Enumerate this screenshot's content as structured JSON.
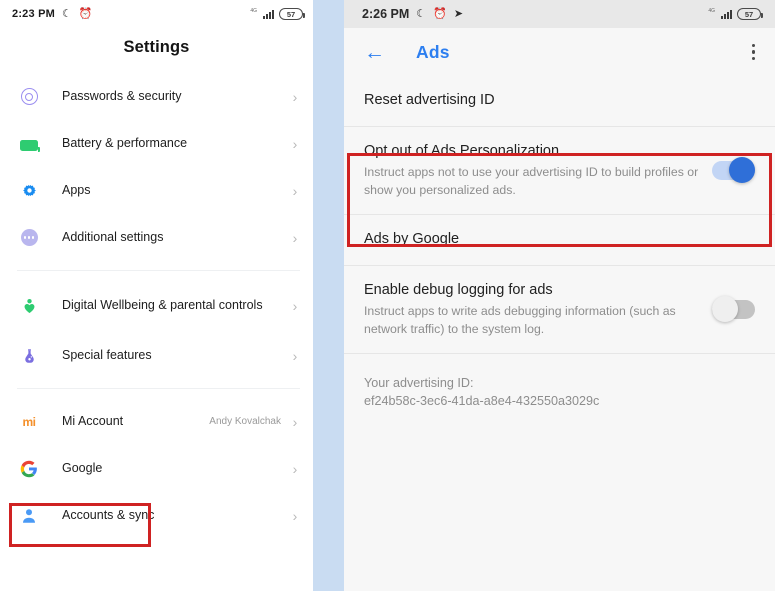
{
  "left_phone": {
    "status_bar": {
      "time": "2:23 PM",
      "icons": [
        "moon-icon",
        "alarm-icon"
      ],
      "signal": "signal-icon",
      "signal_label": "4G",
      "battery": "57"
    },
    "title": "Settings",
    "groups": [
      {
        "items": [
          {
            "label": "Passwords & security",
            "icon": "fingerprint-icon",
            "value": "",
            "chevron": "›"
          },
          {
            "label": "Battery & performance",
            "icon": "battery-icon",
            "value": "",
            "chevron": "›"
          },
          {
            "label": "Apps",
            "icon": "gear-icon",
            "value": "",
            "chevron": "›"
          },
          {
            "label": "Additional settings",
            "icon": "more-dots-icon",
            "value": "",
            "chevron": "›"
          }
        ]
      },
      {
        "items": [
          {
            "label": "Digital Wellbeing & parental controls",
            "icon": "wellbeing-heart-icon",
            "value": "",
            "chevron": "›"
          },
          {
            "label": "Special features",
            "icon": "flask-icon",
            "value": "",
            "chevron": "›"
          }
        ]
      },
      {
        "items": [
          {
            "label": "Mi Account",
            "icon": "mi-logo-icon",
            "value": "Andy Kovalchak",
            "chevron": "›"
          },
          {
            "label": "Google",
            "icon": "google-logo-icon",
            "value": "",
            "chevron": "›"
          },
          {
            "label": "Accounts & sync",
            "icon": "person-icon",
            "value": "",
            "chevron": "›"
          }
        ]
      }
    ],
    "highlight": {
      "target": "Google",
      "color": "#cf2222"
    }
  },
  "right_phone": {
    "status_bar": {
      "time": "2:26 PM",
      "icons": [
        "moon-icon",
        "alarm-icon",
        "telegram-icon"
      ],
      "signal_label": "4G",
      "battery": "57"
    },
    "app_bar": {
      "back": "←",
      "title": "Ads",
      "menu": "overflow-menu-icon",
      "accent_color": "#2d7ff0"
    },
    "rows": [
      {
        "title": "Reset advertising ID",
        "subtitle": "",
        "toggle": null
      },
      {
        "title": "Opt out of Ads Personalization",
        "subtitle": "Instruct apps not to use your advertising ID to build profiles or show you personalized ads.",
        "toggle": "on"
      },
      {
        "title": "Ads by Google",
        "subtitle": "",
        "toggle": null
      },
      {
        "title": "Enable debug logging for ads",
        "subtitle": "Instruct apps to write ads debugging information (such as network traffic) to the system log.",
        "toggle": "off"
      }
    ],
    "advertising_id": {
      "label": "Your advertising ID:",
      "value": "ef24b58c-3ec6-41da-a8e4-432550a3029c"
    },
    "highlight": {
      "target": "Opt out of Ads Personalization",
      "color": "#cf2222"
    }
  },
  "colors": {
    "accent_blue": "#2d7ff0",
    "highlight_red": "#cf2222",
    "gap_band": "#c9dcf2",
    "toggle_on": "#2f6fd8",
    "toggle_off": "#c3c3c3"
  }
}
